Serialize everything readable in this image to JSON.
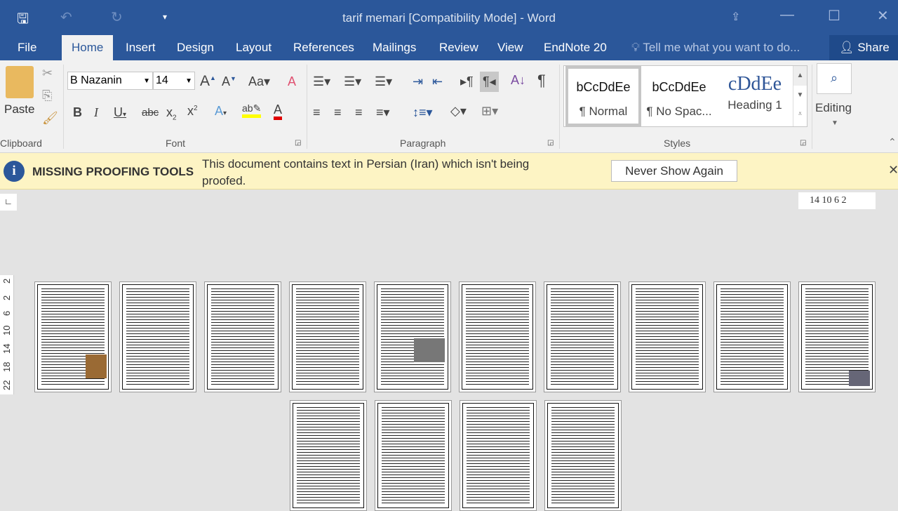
{
  "window": {
    "title": "tarif memari [Compatibility Mode] - Word"
  },
  "tabs": [
    "File",
    "Home",
    "Insert",
    "Design",
    "Layout",
    "References",
    "Mailings",
    "Review",
    "View",
    "EndNote 20"
  ],
  "active_tab": "Home",
  "tell_me": "Tell me what you want to do...",
  "share": "Share",
  "clipboard": {
    "paste": "Paste",
    "group": "Clipboard"
  },
  "font": {
    "name": "B Nazanin",
    "size": "14",
    "group": "Font"
  },
  "paragraph": {
    "group": "Paragraph"
  },
  "styles": {
    "group": "Styles",
    "items": [
      {
        "preview": "bCcDdEe",
        "name": "¶ Normal"
      },
      {
        "preview": "bCcDdEe",
        "name": "¶ No Spac..."
      },
      {
        "preview": "cDdEe",
        "name": "Heading 1"
      }
    ]
  },
  "editing": {
    "label": "Editing"
  },
  "infobar": {
    "title": "MISSING PROOFING TOOLS",
    "message": "This document contains text in Persian (Iran) which isn't being proofed.",
    "button": "Never Show Again"
  },
  "ruler": {
    "labels": "14 10  6   2"
  },
  "vruler": [
    "2",
    "2",
    "6",
    "10",
    "14",
    "18",
    "22"
  ],
  "colors": {
    "brand": "#2b579a",
    "highlight": "#ffff00",
    "font_color": "#e00000"
  },
  "pages_count": 14
}
